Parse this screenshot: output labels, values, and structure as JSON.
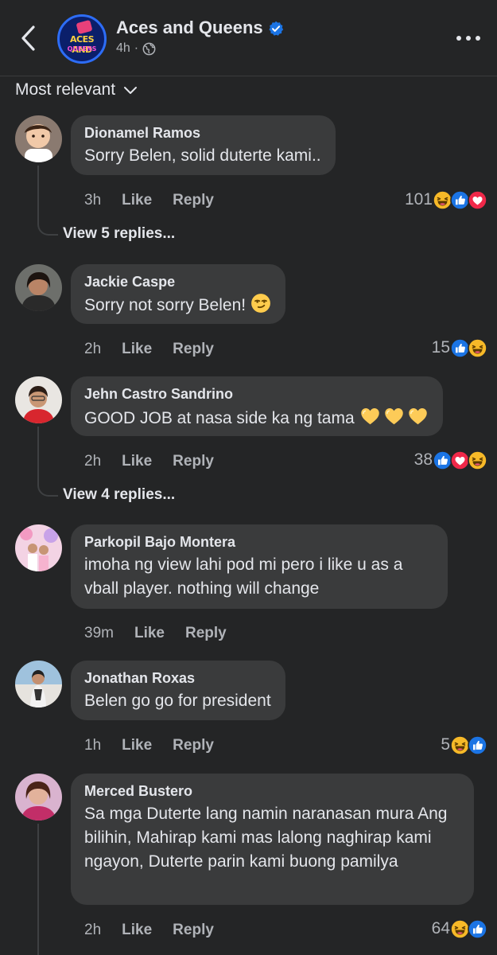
{
  "header": {
    "page_name": "Aces and Queens",
    "post_time": "4h",
    "dot": "·",
    "logo_text": "ACES AND",
    "logo_sub": "QUEENS"
  },
  "sort": {
    "label": "Most relevant"
  },
  "comments": [
    {
      "author": "Dionamel Ramos",
      "text": "Sorry Belen, solid duterte kami..",
      "time": "3h",
      "like": "Like",
      "reply": "Reply",
      "reaction_count": "101",
      "reactions": [
        "haha",
        "like",
        "love"
      ],
      "view_replies": "View 5 replies..."
    },
    {
      "author": "Jackie Caspe",
      "text": "Sorry not sorry Belen!",
      "emoji": "smirk",
      "time": "2h",
      "like": "Like",
      "reply": "Reply",
      "reaction_count": "15",
      "reactions": [
        "like",
        "haha"
      ]
    },
    {
      "author": "Jehn Castro Sandrino",
      "text": "GOOD JOB at nasa side ka ng tama",
      "emoji": "yellow-hearts",
      "time": "2h",
      "like": "Like",
      "reply": "Reply",
      "reaction_count": "38",
      "reactions": [
        "like",
        "love",
        "haha"
      ],
      "view_replies": "View 4 replies..."
    },
    {
      "author": "Parkopil Bajo Montera",
      "text": "imoha ng view lahi pod mi pero i like u as a vball player. nothing will change",
      "time": "39m",
      "like": "Like",
      "reply": "Reply"
    },
    {
      "author": "Jonathan Roxas",
      "text": "Belen go go for president",
      "time": "1h",
      "like": "Like",
      "reply": "Reply",
      "reaction_count": "5",
      "reactions": [
        "haha",
        "like"
      ]
    },
    {
      "author": "Merced Bustero",
      "text": "Sa mga Duterte lang namin naranasan mura Ang bilihin, Mahirap kami mas lalong naghirap kami ngayon, Duterte parin kami buong pamilya",
      "time": "2h",
      "like": "Like",
      "reply": "Reply",
      "reaction_count": "64",
      "reactions": [
        "haha",
        "like"
      ]
    }
  ],
  "colors": {
    "background": "#242526",
    "bubble": "#3a3b3c",
    "like_blue": "#1b74e4",
    "love_red": "#f02849",
    "haha_yellow": "#f7b928",
    "muted_text": "#b0b3b8"
  }
}
